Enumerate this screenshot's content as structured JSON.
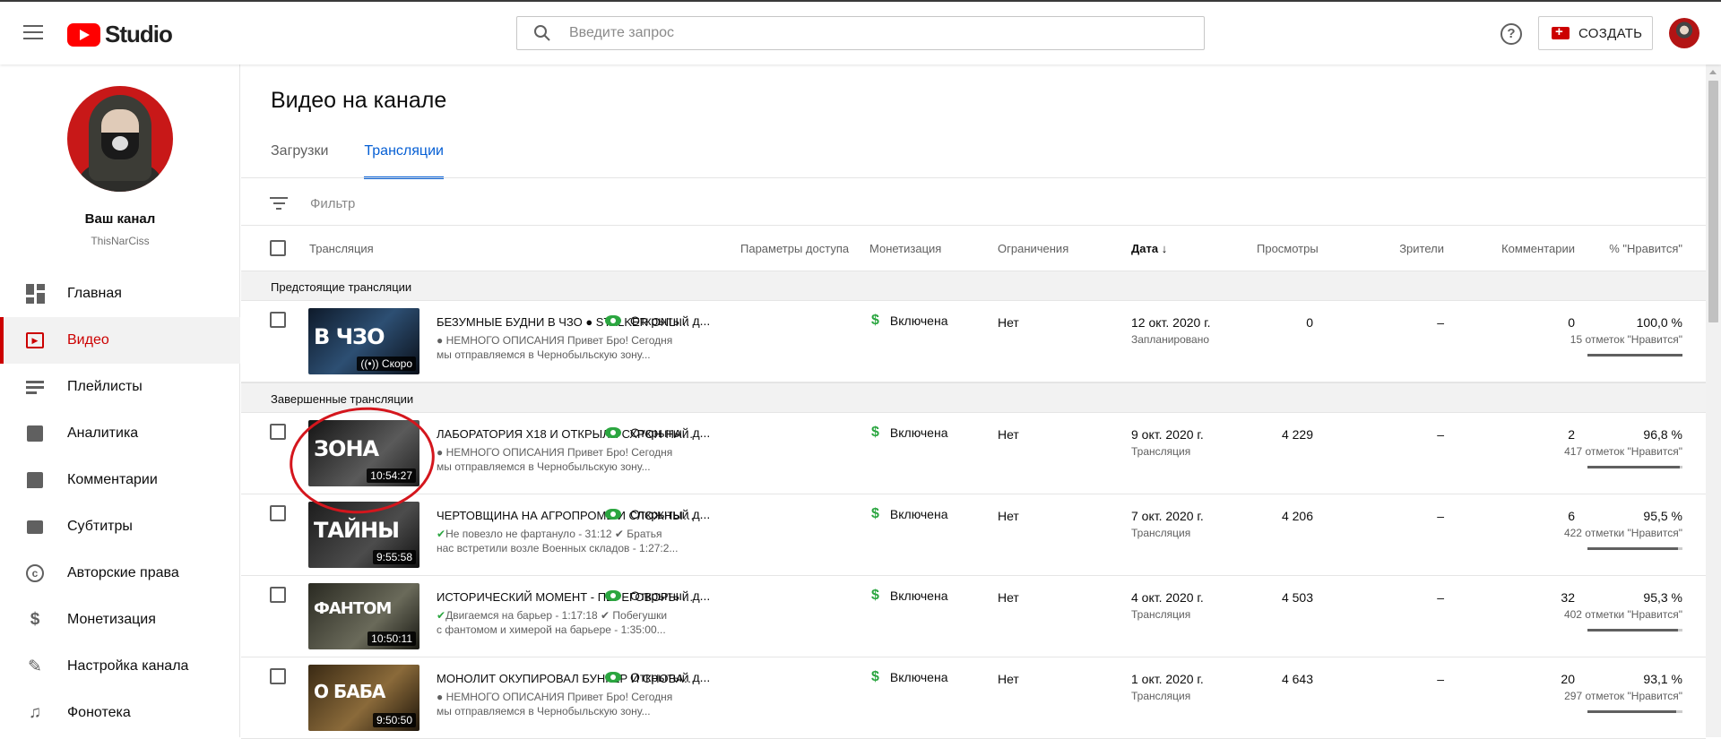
{
  "app": {
    "logo_text": "Studio"
  },
  "search": {
    "placeholder": "Введите запрос"
  },
  "header": {
    "help": "?",
    "create_label": "СОЗДАТЬ"
  },
  "channel": {
    "name": "Ваш канал",
    "handle": "ThisNarCiss"
  },
  "sidebar": {
    "items": [
      {
        "label": "Главная",
        "icon": "dashboard-icon",
        "active": false
      },
      {
        "label": "Видео",
        "icon": "video-icon",
        "active": true
      },
      {
        "label": "Плейлисты",
        "icon": "playlist-icon",
        "active": false
      },
      {
        "label": "Аналитика",
        "icon": "analytics-icon",
        "active": false
      },
      {
        "label": "Комментарии",
        "icon": "comments-icon",
        "active": false
      },
      {
        "label": "Субтитры",
        "icon": "subtitles-icon",
        "active": false
      },
      {
        "label": "Авторские права",
        "icon": "copyright-icon",
        "active": false
      },
      {
        "label": "Монетизация",
        "icon": "dollar-icon",
        "active": false
      },
      {
        "label": "Настройка канала",
        "icon": "customize-icon",
        "active": false
      },
      {
        "label": "Фонотека",
        "icon": "audio-library-icon",
        "active": false
      }
    ]
  },
  "main": {
    "title": "Видео на канале",
    "tabs": [
      {
        "label": "Загрузки",
        "active": false
      },
      {
        "label": "Трансляции",
        "active": true
      }
    ],
    "filter_placeholder": "Фильтр",
    "columns": {
      "stream": "Трансляция",
      "access": "Параметры доступа",
      "monetization": "Монетизация",
      "restrictions": "Ограничения",
      "date": "Дата",
      "views": "Просмотры",
      "viewers": "Зрители",
      "comments": "Комментарии",
      "likes": "% \"Нравится\""
    },
    "section_upcoming": "Предстоящие трансляции",
    "section_completed": "Завершенные трансляции",
    "rows": [
      {
        "thumb_text": "В ЧЗО",
        "duration": "((•)) Скоро",
        "title": "БЕЗУМНЫЕ БУДНИ В ЧЗО ● STALKER ONLINE ● STAY OUT",
        "desc_1": "● НЕМНОГО ОПИСАНИЯ Привет Бро! Сегодня",
        "desc_2": "мы отправляемся в Чернобыльскую зону...",
        "access": "Открытый д...",
        "monetization": "Включена",
        "restrictions": "Нет",
        "date": "12 окт. 2020 г.",
        "status": "Запланировано",
        "views": "0",
        "viewers": "–",
        "comments": "0",
        "likes": "100,0 %",
        "likes_count": "15 отметок \"Нравится\"",
        "like_ratio": 1.0
      },
      {
        "thumb_text": "ЗОНА",
        "duration": "10:54:27",
        "title": "ЛАБОРАТОРИЯ X18 И ОТКРЫЛИ СХРОН НА БАРЬЕРЕ",
        "desc_1": "● НЕМНОГО ОПИСАНИЯ Привет Бро! Сегодня",
        "desc_2": "мы отправляемся в Чернобыльскую зону...",
        "access": "Открытый д...",
        "monetization": "Включена",
        "restrictions": "Нет",
        "date": "9 окт. 2020 г.",
        "status": "Трансляция",
        "views": "4 229",
        "viewers": "–",
        "comments": "2",
        "likes": "96,8 %",
        "likes_count": "417 отметок \"Нравится\"",
        "like_ratio": 0.968
      },
      {
        "thumb_text": "ТАЙНЫ",
        "duration": "9:55:58",
        "title": "ЧЕРТОВЩИНА НА АГРОПРОМЕ И СЛОЖНЫЕ КВЕСТЫ",
        "desc_1": "Не повезло не фартануло - 31:12 ✔ Братья",
        "desc_2": "нас встретили возле Военных складов - 1:27:2...",
        "access": "Открытый д...",
        "monetization": "Включена",
        "restrictions": "Нет",
        "date": "7 окт. 2020 г.",
        "status": "Трансляция",
        "views": "4 206",
        "viewers": "–",
        "comments": "6",
        "likes": "95,5 %",
        "likes_count": "422 отметки \"Нравится\"",
        "like_ratio": 0.955
      },
      {
        "thumb_text": "ФАНТОМ",
        "duration": "10:50:11",
        "title": "ИСТОРИЧЕСКИЙ МОМЕНТ - ПЕРЕГОВОРЫ С ФАНТОМОМ",
        "desc_1": "Двигаемся на барьер - 1:17:18 ✔ Побегушки",
        "desc_2": "с фантомом и химерой на барьере - 1:35:00...",
        "access": "Открытый д...",
        "monetization": "Включена",
        "restrictions": "Нет",
        "date": "4 окт. 2020 г.",
        "status": "Трансляция",
        "views": "4 503",
        "viewers": "–",
        "comments": "32",
        "likes": "95,3 %",
        "likes_count": "402 отметки \"Нравится\"",
        "like_ratio": 0.953
      },
      {
        "thumb_text": "О БАБА",
        "duration": "9:50:50",
        "title": "МОНОЛИТ ОКУПИРОВАЛ БУНКЕР И СНОВА ЧЗО",
        "desc_1": "● НЕМНОГО ОПИСАНИЯ Привет Бро! Сегодня",
        "desc_2": "мы отправляемся в Чернобыльскую зону...",
        "access": "Открытый д...",
        "monetization": "Включена",
        "restrictions": "Нет",
        "date": "1 окт. 2020 г.",
        "status": "Трансляция",
        "views": "4 643",
        "viewers": "–",
        "comments": "20",
        "likes": "93,1 %",
        "likes_count": "297 отметок \"Нравится\"",
        "like_ratio": 0.931
      }
    ]
  },
  "colors": {
    "brand_red": "#ff0000",
    "accent_blue": "#065fd4",
    "active_red": "#cc0000",
    "status_green": "#2ba640",
    "annotation_red": "#d4161d"
  }
}
